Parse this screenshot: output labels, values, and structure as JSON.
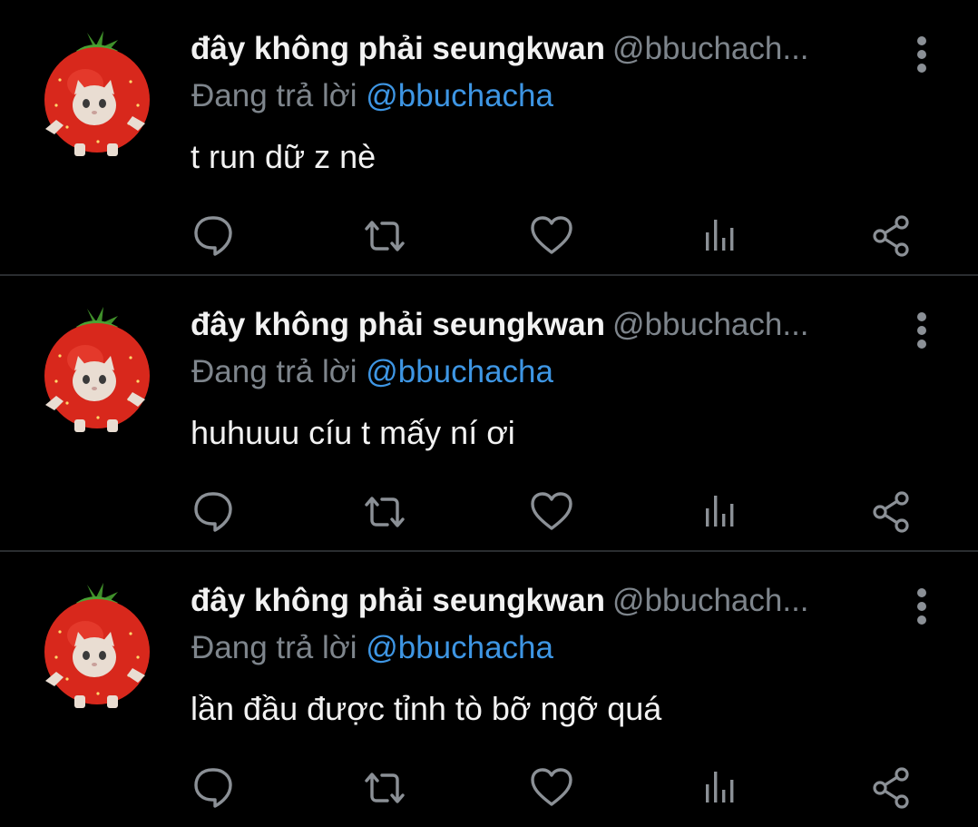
{
  "colors": {
    "background": "#000000",
    "divider": "#2a2d30",
    "name": "#f2f2f2",
    "secondary_text": "#7e858c",
    "mention": "#3e96e4",
    "icon": "#8b9096"
  },
  "icons": {
    "reply": "speech-bubble-icon",
    "retweet": "retweet-arrows-icon",
    "like": "heart-icon",
    "views": "bar-chart-icon",
    "share": "share-nodes-icon",
    "more": "vertical-dots-icon",
    "avatar": "strawberry-cat-avatar"
  },
  "tweets": [
    {
      "name": "đây không phải seungkwan",
      "handle": "@bbuchach...",
      "reply_prefix": "Đang trả lời",
      "reply_to": "@bbuchacha",
      "text": "t run dữ z nè"
    },
    {
      "name": "đây không phải seungkwan",
      "handle": "@bbuchach...",
      "reply_prefix": "Đang trả lời",
      "reply_to": "@bbuchacha",
      "text": "huhuuu cíu t mấy ní ơi"
    },
    {
      "name": "đây không phải seungkwan",
      "handle": "@bbuchach...",
      "reply_prefix": "Đang trả lời",
      "reply_to": "@bbuchacha",
      "text": "lần đầu được tỉnh tò bỡ ngỡ quá"
    }
  ]
}
